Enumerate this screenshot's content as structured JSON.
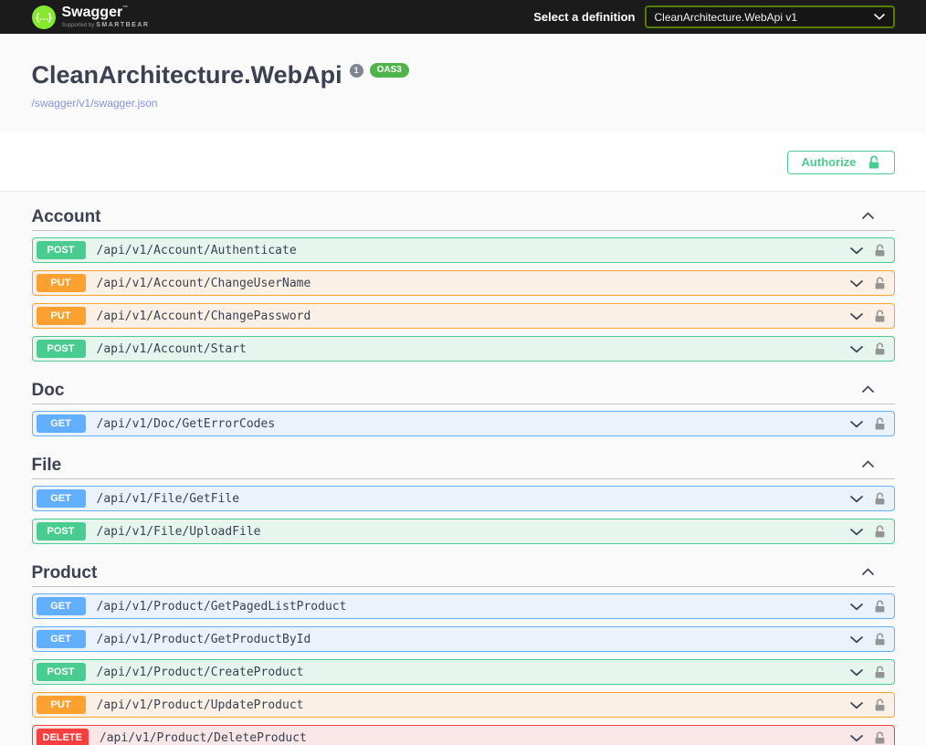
{
  "topbar": {
    "logo_text": "Swagger",
    "trademark": "™",
    "logo_sub_prefix": "Supported by",
    "logo_sub_brand": "SMARTBEAR",
    "select_label": "Select a definition",
    "selected_definition": "CleanArchitecture.WebApi v1"
  },
  "info": {
    "title": "CleanArchitecture.WebApi",
    "version_badge": "1",
    "oas_badge": "OAS3",
    "spec_url": "/swagger/v1/swagger.json"
  },
  "auth": {
    "authorize_label": "Authorize"
  },
  "colors": {
    "get": "#61affe",
    "post": "#49cc90",
    "put": "#fca130",
    "delete": "#f93e3e",
    "logo_green": "#85ea2d",
    "oas_green": "#4fb54a",
    "select_border_green": "#547f00",
    "authorize_green": "#49cc90",
    "topbar_bg": "#1b1b1b",
    "text_dark": "#3b4151",
    "lock_gray": "#949494"
  },
  "sections": [
    {
      "name": "Account",
      "operations": [
        {
          "method": "POST",
          "path": "/api/v1/Account/Authenticate"
        },
        {
          "method": "PUT",
          "path": "/api/v1/Account/ChangeUserName"
        },
        {
          "method": "PUT",
          "path": "/api/v1/Account/ChangePassword"
        },
        {
          "method": "POST",
          "path": "/api/v1/Account/Start"
        }
      ]
    },
    {
      "name": "Doc",
      "operations": [
        {
          "method": "GET",
          "path": "/api/v1/Doc/GetErrorCodes"
        }
      ]
    },
    {
      "name": "File",
      "operations": [
        {
          "method": "GET",
          "path": "/api/v1/File/GetFile"
        },
        {
          "method": "POST",
          "path": "/api/v1/File/UploadFile"
        }
      ]
    },
    {
      "name": "Product",
      "operations": [
        {
          "method": "GET",
          "path": "/api/v1/Product/GetPagedListProduct"
        },
        {
          "method": "GET",
          "path": "/api/v1/Product/GetProductById"
        },
        {
          "method": "POST",
          "path": "/api/v1/Product/CreateProduct"
        },
        {
          "method": "PUT",
          "path": "/api/v1/Product/UpdateProduct"
        },
        {
          "method": "DELETE",
          "path": "/api/v1/Product/DeleteProduct"
        }
      ]
    }
  ]
}
